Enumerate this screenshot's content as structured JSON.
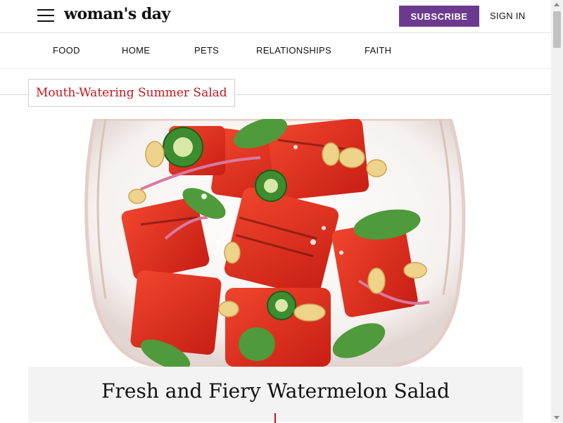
{
  "header": {
    "logo_text": "woman's day",
    "subscribe_label": "SUBSCRIBE",
    "signin_label": "SIGN IN",
    "menu_icon": "hamburger-menu-icon"
  },
  "nav": {
    "items": [
      {
        "label": "FOOD"
      },
      {
        "label": "HOME"
      },
      {
        "label": "PETS"
      },
      {
        "label": "RELATIONSHIPS"
      },
      {
        "label": "FAITH"
      }
    ]
  },
  "article": {
    "tag": "Mouth-Watering Summer Salad",
    "title": "Fresh and Fiery Watermelon Salad",
    "hero_image": "watermelon-salad-bowl-photo"
  },
  "colors": {
    "brand_purple": "#6b3a8f",
    "accent_red": "#c4161c",
    "card_background": "#f3f3f3"
  }
}
